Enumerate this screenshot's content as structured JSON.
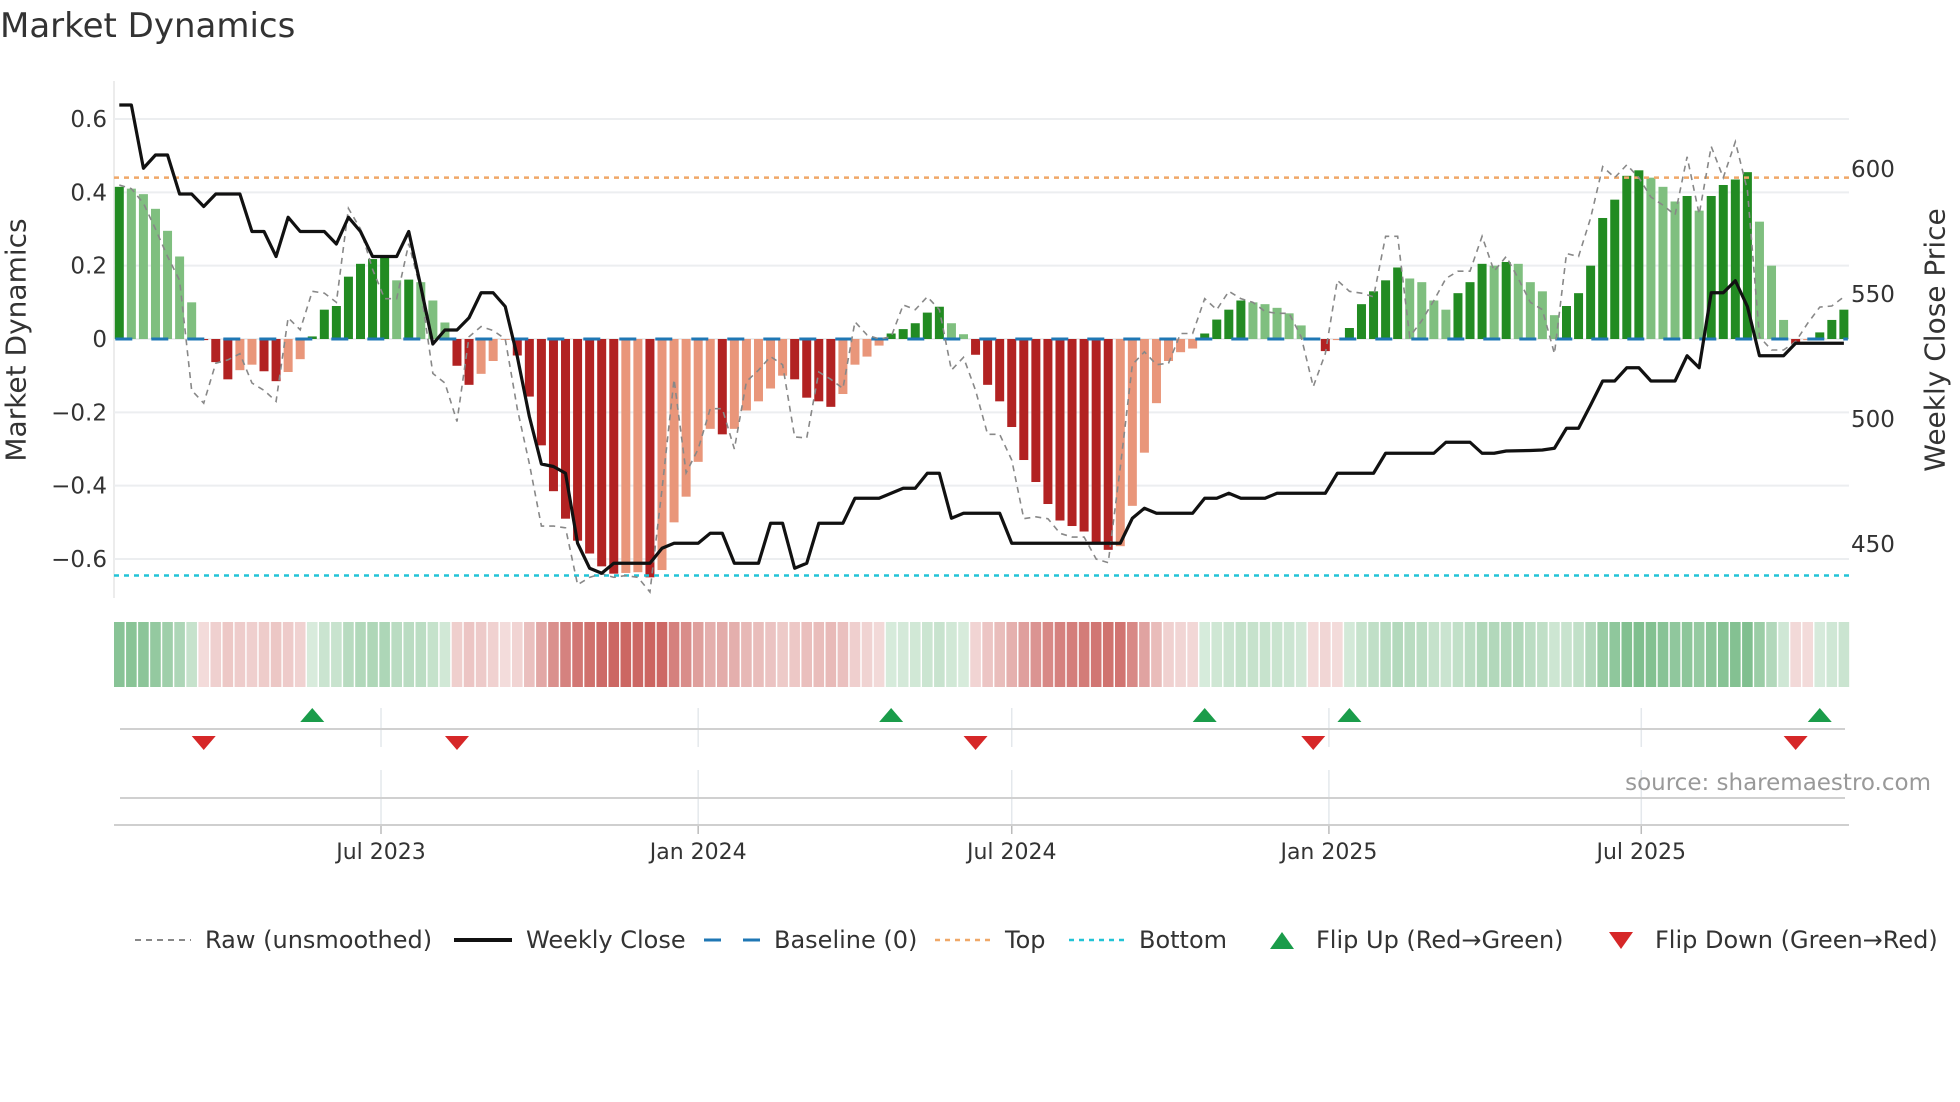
{
  "chart_data": {
    "type": "bar",
    "title": "Market Dynamics",
    "ylabel": "Market Dynamics",
    "ylabel_right": "Weekly Close Price",
    "ylim": [
      -0.7,
      0.7
    ],
    "ylim_right": [
      425,
      630
    ],
    "y_ticks": [
      {
        "v": 0.6,
        "label": "0.6"
      },
      {
        "v": 0.4,
        "label": "0.4"
      },
      {
        "v": 0.2,
        "label": "0.2"
      },
      {
        "v": 0,
        "label": "0"
      },
      {
        "v": -0.2,
        "label": "−0.2"
      },
      {
        "v": -0.4,
        "label": "−0.4"
      },
      {
        "v": -0.6,
        "label": "−0.6"
      }
    ],
    "y_ticks_right": [
      {
        "v": 600,
        "label": "600"
      },
      {
        "v": 550,
        "label": "550"
      },
      {
        "v": 500,
        "label": "500"
      },
      {
        "v": 450,
        "label": "450"
      }
    ],
    "x_ticks": [
      {
        "week": 21.7,
        "label": "Jul 2023"
      },
      {
        "week": 48.0,
        "label": "Jan 2024"
      },
      {
        "week": 74.0,
        "label": "Jul 2024"
      },
      {
        "week": 100.3,
        "label": "Jan 2025"
      },
      {
        "week": 126.2,
        "label": "Jul 2025"
      }
    ],
    "top_level": 0.44,
    "bottom_level": -0.645,
    "baseline": 0,
    "grid": true,
    "legend_position": "bottom",
    "colors": {
      "rise_pos": "#228b22",
      "fall_pos": "#7fbf7f",
      "fall_neg": "#b22222",
      "rise_neg": "#e9967a",
      "raw": "#888888",
      "close": "#111111",
      "baseline": "#1f77b4",
      "top": "#f0a868",
      "bottom": "#22c3d6",
      "flip_up": "#1a9c4a",
      "flip_down": "#d62728"
    },
    "dynamics": [
      0.415,
      0.41,
      0.395,
      0.355,
      0.295,
      0.225,
      0.1,
      -0.003,
      -0.063,
      -0.11,
      -0.085,
      -0.07,
      -0.088,
      -0.115,
      -0.09,
      -0.055,
      0.007,
      0.08,
      0.09,
      0.17,
      0.205,
      0.218,
      0.225,
      0.16,
      0.162,
      0.155,
      0.105,
      0.045,
      -0.073,
      -0.125,
      -0.095,
      -0.06,
      -0.002,
      -0.045,
      -0.157,
      -0.29,
      -0.415,
      -0.49,
      -0.55,
      -0.585,
      -0.62,
      -0.64,
      -0.638,
      -0.636,
      -0.65,
      -0.63,
      -0.5,
      -0.43,
      -0.335,
      -0.245,
      -0.26,
      -0.245,
      -0.195,
      -0.17,
      -0.135,
      -0.1,
      -0.11,
      -0.16,
      -0.17,
      -0.185,
      -0.15,
      -0.07,
      -0.048,
      -0.018,
      0.015,
      0.027,
      0.043,
      0.072,
      0.088,
      0.043,
      0.013,
      -0.043,
      -0.125,
      -0.17,
      -0.24,
      -0.33,
      -0.39,
      -0.45,
      -0.495,
      -0.51,
      -0.525,
      -0.555,
      -0.575,
      -0.565,
      -0.455,
      -0.31,
      -0.175,
      -0.06,
      -0.036,
      -0.026,
      0.015,
      0.053,
      0.08,
      0.105,
      0.1,
      0.095,
      0.085,
      0.07,
      0.037,
      -0.004,
      -0.033,
      -0.003,
      0.03,
      0.095,
      0.13,
      0.16,
      0.195,
      0.165,
      0.155,
      0.105,
      0.08,
      0.125,
      0.155,
      0.205,
      0.2,
      0.21,
      0.205,
      0.155,
      0.13,
      0.065,
      0.09,
      0.125,
      0.2,
      0.33,
      0.38,
      0.445,
      0.46,
      0.44,
      0.415,
      0.375,
      0.39,
      0.35,
      0.39,
      0.42,
      0.435,
      0.455,
      0.32,
      0.2,
      0.052,
      -0.015,
      -0.003,
      0.018,
      0.052,
      0.08
    ],
    "raw": [
      0.42,
      0.41,
      0.37,
      0.3,
      0.225,
      0.16,
      -0.14,
      -0.175,
      -0.066,
      -0.057,
      -0.04,
      -0.12,
      -0.14,
      -0.17,
      0.058,
      0.025,
      0.13,
      0.125,
      0.1,
      0.356,
      0.3,
      0.19,
      0.11,
      0.11,
      0.26,
      0.134,
      -0.094,
      -0.12,
      -0.225,
      0.006,
      0.034,
      0.023,
      0.0,
      -0.19,
      -0.34,
      -0.51,
      -0.51,
      -0.515,
      -0.67,
      -0.65,
      -0.64,
      -0.65,
      -0.645,
      -0.65,
      -0.69,
      -0.41,
      -0.11,
      -0.365,
      -0.3,
      -0.19,
      -0.19,
      -0.3,
      -0.116,
      -0.085,
      -0.048,
      -0.07,
      -0.267,
      -0.27,
      -0.09,
      -0.11,
      -0.135,
      0.047,
      0.011,
      0.0,
      0.006,
      0.093,
      0.08,
      0.115,
      0.08,
      -0.085,
      -0.05,
      -0.14,
      -0.26,
      -0.26,
      -0.33,
      -0.49,
      -0.485,
      -0.49,
      -0.53,
      -0.54,
      -0.54,
      -0.6,
      -0.61,
      -0.35,
      -0.07,
      -0.035,
      -0.07,
      -0.066,
      0.015,
      0.015,
      0.11,
      0.08,
      0.13,
      0.11,
      0.1,
      0.075,
      0.07,
      0.07,
      0.006,
      -0.13,
      -0.04,
      0.16,
      0.13,
      0.125,
      0.115,
      0.28,
      0.28,
      0.006,
      0.05,
      0.105,
      0.165,
      0.185,
      0.185,
      0.28,
      0.185,
      0.225,
      0.165,
      0.1,
      0.08,
      -0.04,
      0.233,
      0.225,
      0.33,
      0.47,
      0.44,
      0.475,
      0.44,
      0.387,
      0.365,
      0.338,
      0.497,
      0.34,
      0.525,
      0.44,
      0.538,
      0.406,
      0.006,
      -0.03,
      -0.03,
      -0.007,
      0.043,
      0.087,
      0.09,
      0.115
    ],
    "close": [
      625.6,
      625.6,
      600.3,
      605.6,
      605.6,
      590,
      590,
      585,
      590,
      590,
      590,
      575,
      575,
      565,
      580.7,
      575,
      575,
      575,
      570,
      580.7,
      575,
      565,
      565,
      565,
      575,
      553,
      530,
      535.6,
      535.6,
      540.5,
      550.5,
      550.5,
      545,
      525,
      501,
      482,
      481,
      478.3,
      450.3,
      440.3,
      438.3,
      442.3,
      442.3,
      442.3,
      442.3,
      448.3,
      450.3,
      450.3,
      450.3,
      454.3,
      454.3,
      442.3,
      442.3,
      442.3,
      458.3,
      458.3,
      440.3,
      442.3,
      458.3,
      458.3,
      458.3,
      468.3,
      468.3,
      468.3,
      470.3,
      472.3,
      472.3,
      478.3,
      478.3,
      460.3,
      462.3,
      462.3,
      462.3,
      462.3,
      450.3,
      450.3,
      450.3,
      450.3,
      450.3,
      450.3,
      450.3,
      450.3,
      450.3,
      450.3,
      460.3,
      464.3,
      462.3,
      462.3,
      462.3,
      462.3,
      468.3,
      468.3,
      470.3,
      468.3,
      468.3,
      468.3,
      470.3,
      470.3,
      470.3,
      470.3,
      470.3,
      478.3,
      478.3,
      478.3,
      478.3,
      486.3,
      486.3,
      486.3,
      486.3,
      486.3,
      490.7,
      490.7,
      490.7,
      486.3,
      486.3,
      487.2,
      487.3,
      487.4,
      487.6,
      488.3,
      496.3,
      496.3,
      505.6,
      515.2,
      515.2,
      520.5,
      520.5,
      515.2,
      515.2,
      515.2,
      525.3,
      520.5,
      550.5,
      550.5,
      555.3,
      545,
      525.3,
      525.3,
      525.3,
      530.3,
      530.3,
      530.3,
      530.3,
      530.3
    ],
    "flips": [
      {
        "week": 7,
        "dir": "down"
      },
      {
        "week": 16,
        "dir": "up"
      },
      {
        "week": 28,
        "dir": "down"
      },
      {
        "week": 64,
        "dir": "up"
      },
      {
        "week": 71,
        "dir": "down"
      },
      {
        "week": 90,
        "dir": "up"
      },
      {
        "week": 99,
        "dir": "down"
      },
      {
        "week": 102,
        "dir": "up"
      },
      {
        "week": 139,
        "dir": "down"
      },
      {
        "week": 141,
        "dir": "up"
      }
    ],
    "legend": [
      {
        "label": "Raw (unsmoothed)",
        "icon": "dashed-gray-line"
      },
      {
        "label": "Weekly Close",
        "icon": "solid-black-line"
      },
      {
        "label": "Baseline (0)",
        "icon": "dashed-blue-line"
      },
      {
        "label": "Top",
        "icon": "dotted-orange-line"
      },
      {
        "label": "Bottom",
        "icon": "dotted-cyan-line"
      },
      {
        "label": "Flip Up (Red→Green)",
        "icon": "green-up-triangle"
      },
      {
        "label": "Flip Down (Green→Red)",
        "icon": "red-down-triangle"
      }
    ],
    "source": "source: sharemaestro.com"
  }
}
